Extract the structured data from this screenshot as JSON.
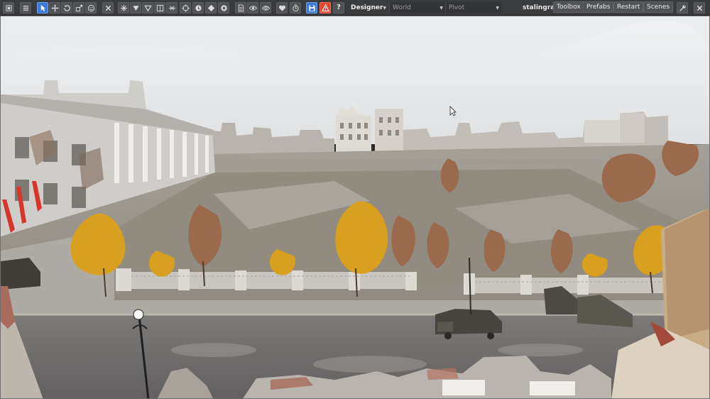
{
  "toolbar": {
    "tools": [
      {
        "name": "menu",
        "icon": "menu-icon"
      },
      {
        "name": "select",
        "icon": "cursor-icon"
      },
      {
        "name": "translate",
        "icon": "move-icon"
      },
      {
        "name": "rotate",
        "icon": "rotate-icon"
      },
      {
        "name": "scale",
        "icon": "scale-icon"
      },
      {
        "name": "emote",
        "icon": "smiley-icon"
      },
      {
        "name": "delete",
        "icon": "close-icon"
      },
      {
        "name": "snap",
        "icon": "snap-icon"
      },
      {
        "name": "terrain",
        "icon": "triangle-down-icon"
      },
      {
        "name": "ground",
        "icon": "triangle-outline-icon"
      },
      {
        "name": "grid",
        "icon": "grid-icon"
      },
      {
        "name": "align",
        "icon": "align-icon"
      },
      {
        "name": "target",
        "icon": "crosshair-icon"
      },
      {
        "name": "toggle-a",
        "icon": "disc-icon"
      },
      {
        "name": "diamond",
        "icon": "diamond-icon"
      },
      {
        "name": "toggle-b",
        "icon": "disc-outline-icon"
      },
      {
        "name": "document",
        "icon": "document-icon"
      },
      {
        "name": "visibility",
        "icon": "eye-icon"
      },
      {
        "name": "preview",
        "icon": "eye-outline-icon"
      },
      {
        "name": "favorite",
        "icon": "heart-icon"
      },
      {
        "name": "history",
        "icon": "clock-icon"
      },
      {
        "name": "save",
        "icon": "save-icon"
      },
      {
        "name": "warning",
        "icon": "warning-icon"
      },
      {
        "name": "help",
        "icon": "help-icon"
      }
    ],
    "mode_select": {
      "value": "Designer"
    },
    "space_select": {
      "value": "World"
    },
    "pivot_select": {
      "value": "Pivot"
    },
    "world_name": "stalingrad",
    "buttons": {
      "toolbox": "Toolbox",
      "prefabs": "Prefabs",
      "restart": "Restart",
      "scenes": "Scenes"
    },
    "warning_glyph": "!",
    "help_glyph": "?",
    "colors": {
      "toolbar_bg": "#3a3b3d",
      "active_tool": "#3b7ad6",
      "warning_tool": "#e0472e"
    }
  }
}
